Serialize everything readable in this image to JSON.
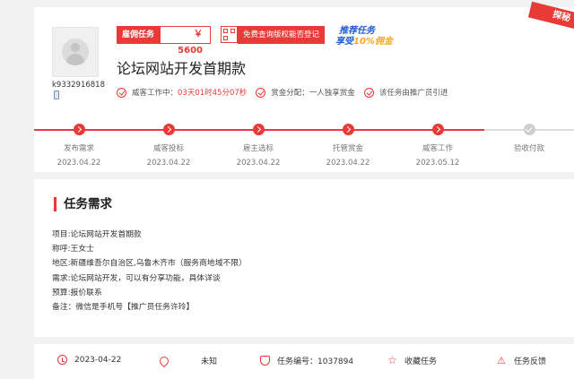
{
  "header": {
    "user_id": "k9332916818",
    "reward_tag": "雇佣任务",
    "reward_price": "￥ 5600",
    "free_check_button": "免费查询版权能否登记",
    "promo_line1": "推荐任务",
    "promo_line2_a": "享受",
    "promo_line2_b": "10%佣金",
    "corner_badge": "探秘",
    "task_title": "论坛网站开发首期款",
    "status_label": "威客工作中：",
    "status_time": "03天01时45分07秒",
    "allocation_label": "赏金分配：",
    "allocation_value": "一人独享赏金",
    "promoter_text": "该任务由推广员引进"
  },
  "progress": {
    "steps": [
      {
        "label": "发布需求",
        "date": "2023.04.22",
        "done": true
      },
      {
        "label": "威客投标",
        "date": "2023.04.22",
        "done": true
      },
      {
        "label": "雇主选标",
        "date": "2023.04.22",
        "done": true
      },
      {
        "label": "托管赏金",
        "date": "2023.04.22",
        "done": true
      },
      {
        "label": "威客工作",
        "date": "2023.05.12",
        "done": true
      },
      {
        "label": "验收付款",
        "date": "",
        "done": false
      }
    ]
  },
  "requirements": {
    "title": "任务需求",
    "lines": [
      "项目:论坛网站开发首期款",
      "称呼:王女士",
      "地区:新疆维吾尔自治区,乌鲁木齐市（服务商地域不限）",
      "需求:论坛网站开发，可以有分享功能，具体详谈",
      "预算:报价联系",
      "备注：微信是手机号【推广员任务许玲】"
    ]
  },
  "footer": {
    "date": "2023-04-22",
    "location": "未知",
    "task_number": "任务编号：1037894",
    "favorite": "收藏任务",
    "feedback": "任务反馈"
  },
  "colors": {
    "accent": "#e83a36",
    "promo_blue": "#1e5bd6"
  }
}
